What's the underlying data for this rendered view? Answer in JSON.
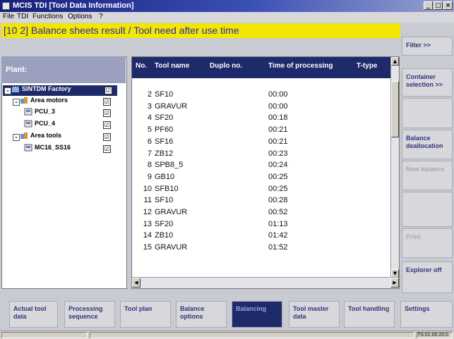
{
  "window": {
    "title": "MCIS TDI [Tool Data Information]"
  },
  "menu": [
    "File",
    "TDI",
    "Functions",
    "Options",
    "?"
  ],
  "banner": "[10 2] Balance sheets result / Tool need after use time",
  "plant": {
    "header": "Plant:",
    "nodes": [
      {
        "label": "SINTDM Factory",
        "checked": "☑"
      },
      {
        "label": "Area motors",
        "checked": "☑"
      },
      {
        "label": "PCU_3",
        "checked": "☑"
      },
      {
        "label": "PCU_4",
        "checked": "☑"
      },
      {
        "label": "Area tools",
        "checked": "☑"
      },
      {
        "label": "MC16_SS16",
        "checked": "☑"
      }
    ]
  },
  "table": {
    "headers": [
      "No.",
      "Tool name",
      "Duplo no.",
      "Time of processing",
      "T-type"
    ],
    "rows": [
      [
        "2",
        "SF10",
        "",
        "00:00"
      ],
      [
        "3",
        "GRAVUR",
        "",
        "00:00"
      ],
      [
        "4",
        "SF20",
        "",
        "00:18"
      ],
      [
        "5",
        "PF60",
        "",
        "00:21"
      ],
      [
        "6",
        "SF16",
        "",
        "00:21"
      ],
      [
        "7",
        "ZB12",
        "",
        "00:23"
      ],
      [
        "8",
        "SPB8_5",
        "",
        "00:24"
      ],
      [
        "9",
        "GB10",
        "",
        "00:25"
      ],
      [
        "10",
        "SFB10",
        "",
        "00:25"
      ],
      [
        "11",
        "SF10",
        "",
        "00:28"
      ],
      [
        "12",
        "GRAVUR",
        "",
        "00:52"
      ],
      [
        "13",
        "SF20",
        "",
        "01:13"
      ],
      [
        "14",
        "ZB10",
        "",
        "01:42"
      ],
      [
        "15",
        "GRAVUR",
        "",
        "01:52"
      ]
    ]
  },
  "softkeys_vertical": [
    "Filter >>",
    "Container selection >>",
    "",
    "Balance deallocation",
    "New balance",
    "",
    "Print",
    "Explorer off"
  ],
  "softkeys_horizontal": [
    "Actual tool data",
    "Processing sequence",
    "Tool plan",
    "Balance options",
    "Balancing",
    "Tool master data",
    "Tool handling",
    "Settings"
  ],
  "statusbar": {
    "left": "",
    "middle": "",
    "right": "TS:01:00:20:0"
  },
  "icons": {
    "app": "app-icon",
    "factory": "factory-icon",
    "area": "area-icon",
    "machine": "machine-icon"
  },
  "colors": {
    "banner": "#f3e600",
    "header": "#1f2a6a",
    "tree_header": "#9aa0bd"
  }
}
